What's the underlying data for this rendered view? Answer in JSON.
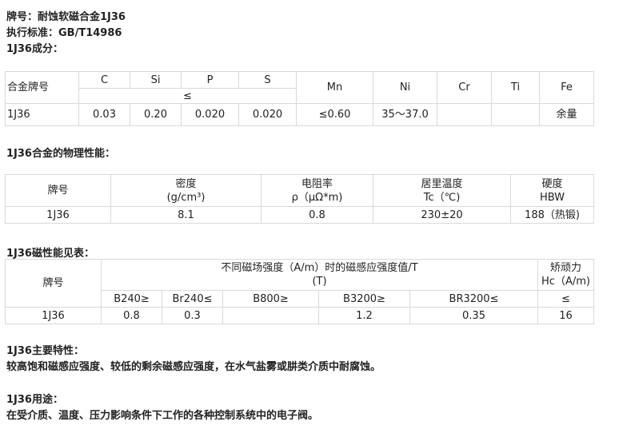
{
  "header": {
    "grade_line": "牌号：耐蚀软磁合金1J36",
    "standard_line": "执行标准：GB/T14986",
    "composition_title": "1J36成分："
  },
  "composition_table": {
    "alloy_label": "合金牌号",
    "elements": [
      "C",
      "Si",
      "P",
      "S",
      "Mn",
      "Ni",
      "Cr",
      "Ti",
      "Fe"
    ],
    "le_symbol": "≤",
    "row": {
      "grade": "1J36",
      "values": [
        "0.03",
        "0.20",
        "0.020",
        "0.020",
        "≤0.60",
        "35～37.0",
        "",
        "",
        "余量"
      ]
    }
  },
  "physical": {
    "title": "1J36合金的物理性能：",
    "headers": {
      "grade": "牌号",
      "density": "密度",
      "density_unit": "(g/cm³)",
      "resistivity": "电阻率",
      "resistivity_unit": "ρ（μΩ*m)",
      "curie": "居里温度",
      "curie_unit": "Tc（℃)",
      "hardness": "硬度",
      "hardness_unit": "HBW"
    },
    "row": {
      "grade": "1J36",
      "density": "8.1",
      "resistivity": "0.8",
      "curie": "230±20",
      "hardness": "188（热锻)"
    }
  },
  "magnetic": {
    "title": "1J36磁性能见表：",
    "headers": {
      "grade": "牌号",
      "induction_line1": "不同磁场强度（A/m）时的磁感应强度值/T",
      "induction_line2": "(T)",
      "coercivity": "矫顽力",
      "coercivity_unit": "Hc（A/m)",
      "sub": [
        "B240≥",
        "Br240≤",
        "B800≥",
        "B3200≥",
        "BR3200≤",
        "≤"
      ]
    },
    "row": {
      "grade": "1J36",
      "values": [
        "0.8",
        "0.3",
        "",
        "1.2",
        "0.35",
        "16"
      ]
    }
  },
  "features": {
    "title": "1J36主要特性：",
    "text": "较高饱和磁感应强度、较低的剩余磁感应强度，在水气盐雾或肼类介质中耐腐蚀。"
  },
  "usage": {
    "title": "1J36用途：",
    "text": "在受介质、温度、压力影响条件下工作的各种控制系统中的电子阀。"
  }
}
